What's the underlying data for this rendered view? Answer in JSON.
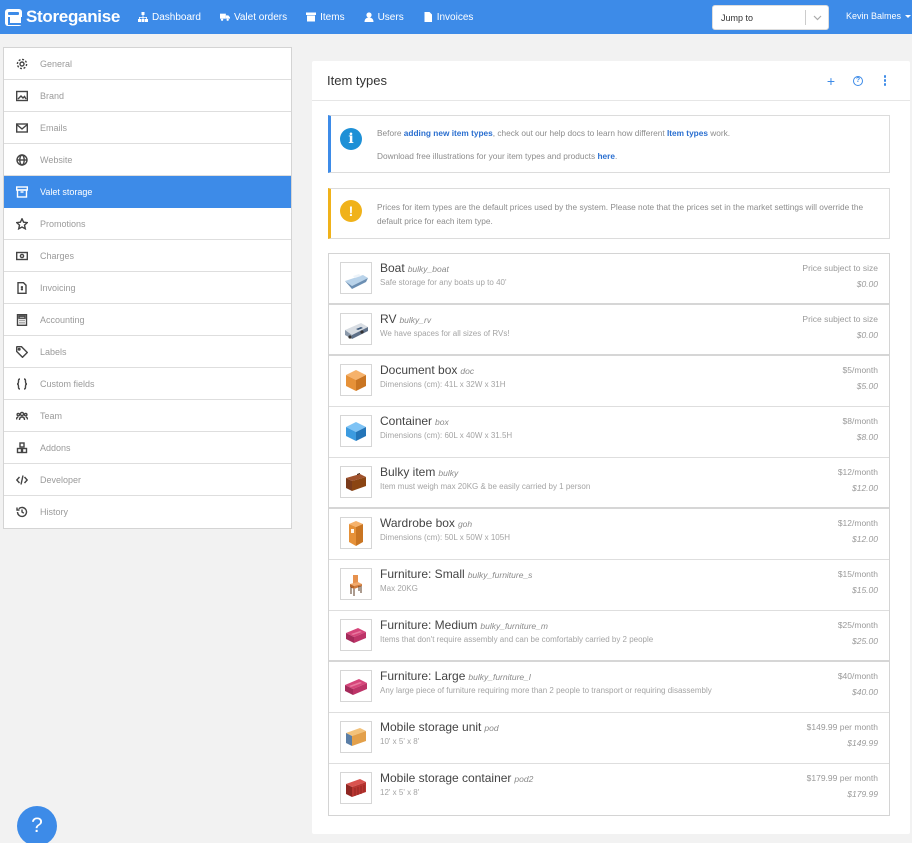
{
  "navbar": {
    "brand": "Storeganise",
    "items": [
      {
        "label": "Dashboard",
        "icon": "sitemap-icon"
      },
      {
        "label": "Valet orders",
        "icon": "truck-icon"
      },
      {
        "label": "Items",
        "icon": "archive-icon"
      },
      {
        "label": "Users",
        "icon": "user-icon"
      },
      {
        "label": "Invoices",
        "icon": "file-icon"
      }
    ],
    "jump_to": "Jump to",
    "user": "Kevin Balmes"
  },
  "sidebar": {
    "items": [
      {
        "label": "General",
        "icon": "gear-icon"
      },
      {
        "label": "Brand",
        "icon": "image-icon"
      },
      {
        "label": "Emails",
        "icon": "envelope-icon"
      },
      {
        "label": "Website",
        "icon": "globe-icon"
      },
      {
        "label": "Valet storage",
        "icon": "box-icon",
        "active": true
      },
      {
        "label": "Promotions",
        "icon": "star-icon"
      },
      {
        "label": "Charges",
        "icon": "money-icon"
      },
      {
        "label": "Invoicing",
        "icon": "invoice-icon"
      },
      {
        "label": "Accounting",
        "icon": "calculator-icon"
      },
      {
        "label": "Labels",
        "icon": "tags-icon"
      },
      {
        "label": "Custom fields",
        "icon": "braces-icon"
      },
      {
        "label": "Team",
        "icon": "team-icon"
      },
      {
        "label": "Addons",
        "icon": "cubes-icon"
      },
      {
        "label": "Developer",
        "icon": "code-icon"
      },
      {
        "label": "History",
        "icon": "history-icon"
      }
    ]
  },
  "panel": {
    "title": "Item types",
    "actions": {
      "add": "+",
      "help": "?"
    }
  },
  "info_alert": {
    "l1_pre": "Before ",
    "l1_link1": "adding new item types",
    "l1_mid": ", check out our help docs to learn how different ",
    "l1_link2": "Item types",
    "l1_post": " work.",
    "l2_pre": "Download free illustrations for your item types and products ",
    "l2_link": "here",
    "l2_post": "."
  },
  "warn_alert": {
    "text": "Prices for item types are the default prices used by the system. Please note that the prices set in the market settings will override the default price for each item type."
  },
  "items": [
    {
      "name": "Boat",
      "code": "bulky_boat",
      "desc": "Safe storage for any boats up to 40'",
      "price": "Price subject to size",
      "default_price": "$0.00",
      "icon": "boat-icon"
    },
    {
      "name": "RV",
      "code": "bulky_rv",
      "desc": "We have spaces for all sizes of RVs!",
      "price": "Price subject to size",
      "default_price": "$0.00",
      "icon": "rv-icon"
    },
    {
      "name": "Document box",
      "code": "doc",
      "desc": "Dimensions (cm): 41L x 32W x 31H",
      "price": "$5/month",
      "default_price": "$5.00",
      "icon": "document-box-icon"
    },
    {
      "name": "Container",
      "code": "box",
      "desc": "Dimensions (cm): 60L x 40W x 31.5H",
      "price": "$8/month",
      "default_price": "$8.00",
      "icon": "container-icon"
    },
    {
      "name": "Bulky item",
      "code": "bulky",
      "desc": "Item must weigh max 20KG & be easily carried by 1 person",
      "price": "$12/month",
      "default_price": "$12.00",
      "icon": "suitcase-icon"
    },
    {
      "name": "Wardrobe box",
      "code": "goh",
      "desc": "Dimensions (cm): 50L x 50W x 105H",
      "price": "$12/month",
      "default_price": "$12.00",
      "icon": "wardrobe-box-icon"
    },
    {
      "name": "Furniture: Small",
      "code": "bulky_furniture_s",
      "desc": "Max 20KG",
      "price": "$15/month",
      "default_price": "$15.00",
      "icon": "chair-icon"
    },
    {
      "name": "Furniture: Medium",
      "code": "bulky_furniture_m",
      "desc": "Items that don't require assembly and can be comfortably carried by 2 people",
      "price": "$25/month",
      "default_price": "$25.00",
      "icon": "armchair-icon"
    },
    {
      "name": "Furniture: Large",
      "code": "bulky_furniture_l",
      "desc": "Any large piece of furniture requiring more than 2 people to transport or requiring disassembly",
      "price": "$40/month",
      "default_price": "$40.00",
      "icon": "sofa-icon"
    },
    {
      "name": "Mobile storage unit",
      "code": "pod",
      "desc": "10' x 5' x 8'",
      "price": "$149.99 per month",
      "default_price": "$149.99",
      "icon": "pod-icon"
    },
    {
      "name": "Mobile storage container",
      "code": "pod2",
      "desc": "12' x 5' x 8'",
      "price": "$179.99 per month",
      "default_price": "$179.99",
      "icon": "pod2-icon"
    }
  ],
  "fab": "?"
}
